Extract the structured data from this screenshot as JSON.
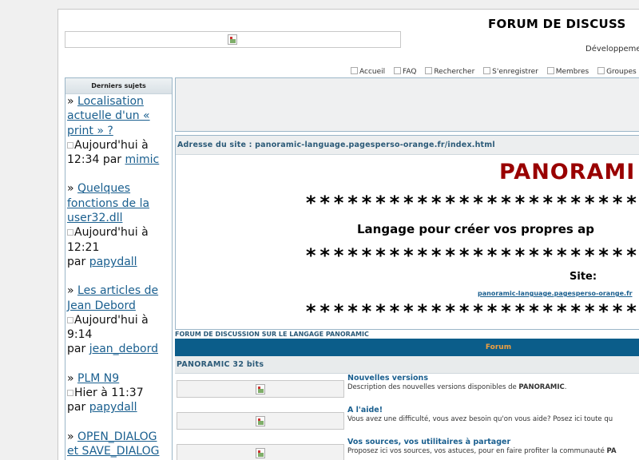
{
  "header": {
    "title": "FORUM DE DISCUSS",
    "subtitle": "Développemen"
  },
  "nav": {
    "items": [
      "Accueil",
      "FAQ",
      "Rechercher",
      "S'enregistrer",
      "Membres",
      "Groupes"
    ]
  },
  "sidebar": {
    "title": "Derniers sujets",
    "topics": [
      {
        "prefix": "»",
        "title": "Localisation actuelle d'un « print » ?",
        "date": "Aujourd'hui à 12:34",
        "by": "par",
        "author": "mimic"
      },
      {
        "prefix": "»",
        "title": "Quelques fonctions de la user32.dll",
        "date": "Aujourd'hui à 12:21",
        "by": "par",
        "author": "papydall"
      },
      {
        "prefix": "»",
        "title": "Les articles de Jean Debord",
        "date": "Aujourd'hui à 9:14",
        "by": "par",
        "author": "jean_debord"
      },
      {
        "prefix": "»",
        "title": "PLM N9",
        "date": "Hier à 11:37",
        "by": "par",
        "author": "papydall"
      },
      {
        "prefix": "»",
        "title": "OPEN_DIALOG et SAVE_DIALOG"
      }
    ]
  },
  "site": {
    "address": "Adresse du site : panoramic-language.pagesperso-orange.fr/index.html",
    "brand": "PANORAMI",
    "stars": "*****************************",
    "tagline": "Langage pour créer vos propres ap",
    "site_label": "Site:",
    "site_link": "panoramic-language.pagesperso-orange.fr"
  },
  "forum": {
    "caption": "FORUM DE DISCUSSION SUR LE LANGAGE PANORAMIC",
    "column": "Forum",
    "category": "PANORAMIC 32 bits",
    "rows": [
      {
        "name": "Nouvelles versions",
        "desc_pre": "Description des nouvelles versions disponibles de ",
        "desc_bold": "PANORAMIC",
        "desc_post": "."
      },
      {
        "name": "A l'aide!",
        "desc_pre": "Vous avez une difficulté, vous avez besoin qu'on vous aide? Posez ici toute qu",
        "desc_bold": "",
        "desc_post": ""
      },
      {
        "name": "Vos sources, vos utilitaires à partager",
        "desc_pre": "Proposez ici vos sources, vos astuces, pour en faire profiter la communauté ",
        "desc_bold": "PA",
        "desc_post": ""
      }
    ]
  }
}
